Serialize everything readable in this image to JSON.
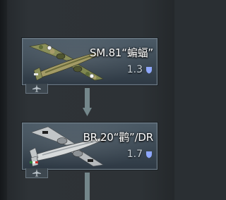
{
  "research_tree": {
    "vehicles": [
      {
        "name": "SM.81“蝙蝠”",
        "battle_rating": "1.3",
        "plane_icon": "sm81-bomber-icon",
        "role_icon": "bomber-role-icon"
      },
      {
        "name": "BR.20“鹳”/DR",
        "battle_rating": "1.7",
        "plane_icon": "br20-bomber-icon",
        "role_icon": "bomber-role-icon"
      }
    ],
    "connector_icon": "down-arrow-icon",
    "colors": {
      "card_top": "#4b5a66",
      "card_bottom": "#2e3944",
      "arrow": "#74878b",
      "shield": "#8fa8ff"
    }
  }
}
